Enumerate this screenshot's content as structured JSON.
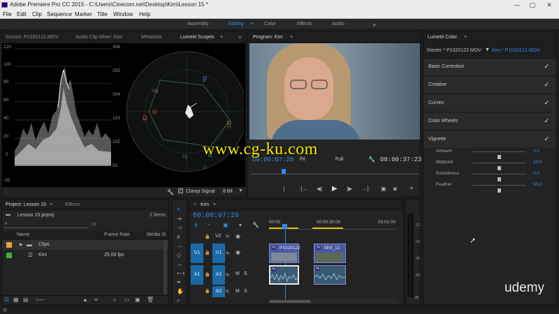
{
  "window": {
    "title": "Adobe Premiere Pro CC 2015 - C:\\Users\\Cinecom.net\\Desktop\\Kim\\Lesson 15 *",
    "minimize": "—",
    "maximize": "▢",
    "close": "✕"
  },
  "menu": [
    "File",
    "Edit",
    "Clip",
    "Sequence",
    "Marker",
    "Title",
    "Window",
    "Help"
  ],
  "workspaces": {
    "items": [
      "Assembly",
      "Editing",
      "Color",
      "Effects",
      "Audio"
    ],
    "active": "Editing",
    "more": "»"
  },
  "source_panel": {
    "tabs": [
      "Source: P1020122.MOV",
      "Audio Clip Mixer: Kim",
      "Metadata",
      "Lumetri Scopes"
    ],
    "active_tab": "Lumetri Scopes",
    "more": "»",
    "waveform_left_scale": [
      "120",
      "100",
      "80",
      "60",
      "40",
      "20",
      "0",
      "-20"
    ],
    "waveform_right_scale": [
      "306",
      "255",
      "204",
      "153",
      "102",
      "51"
    ],
    "vectorscope_labels": [
      "R",
      "Mg",
      "B",
      "Cy",
      "G",
      "Yl"
    ],
    "clamp_signal": "Clamp Signal",
    "bit_depth": "8 Bit"
  },
  "program_monitor": {
    "title": "Program: Kim",
    "current_time": "00:00:07:20",
    "fit": "Fit",
    "quality": "Full",
    "duration": "00:00:37:23"
  },
  "watermark": "www.cg-ku.com",
  "lumetri": {
    "panel_title": "Lumetri Color",
    "master_tab": "Master * P1020122.MOV",
    "clip_tab": "Kim * P1020122.MOV",
    "sections": [
      "Basic Correction",
      "Creative",
      "Curves",
      "Color Wheels",
      "Vignette"
    ],
    "check": "✓",
    "vignette": [
      {
        "label": "Amount",
        "value": "0,0",
        "level": 0.5
      },
      {
        "label": "Midpoint",
        "value": "50,0",
        "level": 0.5
      },
      {
        "label": "Roundness",
        "value": "0,0",
        "level": 0.5
      },
      {
        "label": "Feather",
        "value": "50,0",
        "level": 0.5
      }
    ]
  },
  "project": {
    "tabs": [
      "Project: Lesson 15",
      "Effects"
    ],
    "file": "Lesson 15.prproj",
    "count": "2 Items",
    "columns": [
      "Name",
      "Frame Rate",
      "Media St"
    ],
    "items": [
      {
        "name": "Clips",
        "frame_rate": "",
        "color": "#e8a33c"
      },
      {
        "name": "Kim",
        "frame_rate": "25,00 fps",
        "color": "#3fae3f"
      }
    ]
  },
  "timeline": {
    "sequence": "Kim",
    "current_time": "00:00:07:20",
    "ruler": [
      "00:00",
      "00:00:30:00",
      "00:01:00"
    ],
    "tracks": {
      "v2": "V2",
      "v1_src": "V1",
      "v1": "V1",
      "a1_src": "A1",
      "a1": "A1",
      "a2": "A2",
      "m": "M",
      "s": "S"
    },
    "clips": [
      "P1020122",
      "MVI_12"
    ]
  },
  "meter_scale": [
    "-12",
    "-24",
    "-36",
    "-48",
    "dB"
  ],
  "branding": "udemy"
}
